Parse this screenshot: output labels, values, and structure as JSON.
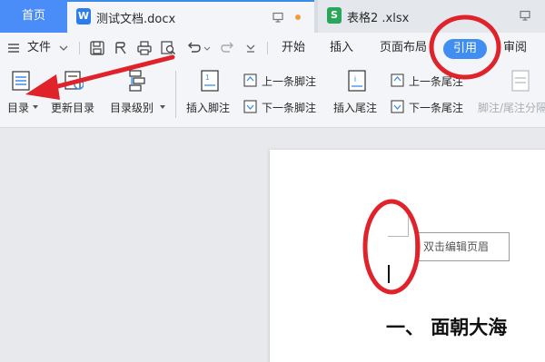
{
  "tabs": {
    "home": "首页",
    "doc_title": "测试文档.docx",
    "sheet_title": "表格2 .xlsx"
  },
  "menu": {
    "file": "文件",
    "items": [
      "开始",
      "插入",
      "页面布局",
      "引用",
      "审阅"
    ],
    "active": "引用"
  },
  "ribbon": {
    "toc": "目录",
    "update_toc": "更新目录",
    "toc_level": "目录级别",
    "insert_footnote": "插入脚注",
    "prev_footnote": "上一条脚注",
    "next_footnote": "下一条脚注",
    "insert_endnote": "插入尾注",
    "prev_endnote": "上一条尾注",
    "next_endnote": "下一条尾注",
    "footnote_sep": "脚注/尾注分隔"
  },
  "document": {
    "header_hint": "双击编辑页眉",
    "heading": "一、 面朝大海"
  },
  "colors": {
    "accent": "#3f8ef0",
    "annotation": "#e0222a",
    "doc_icon": "#2b7cf0",
    "sheet_icon": "#2aa65b"
  }
}
